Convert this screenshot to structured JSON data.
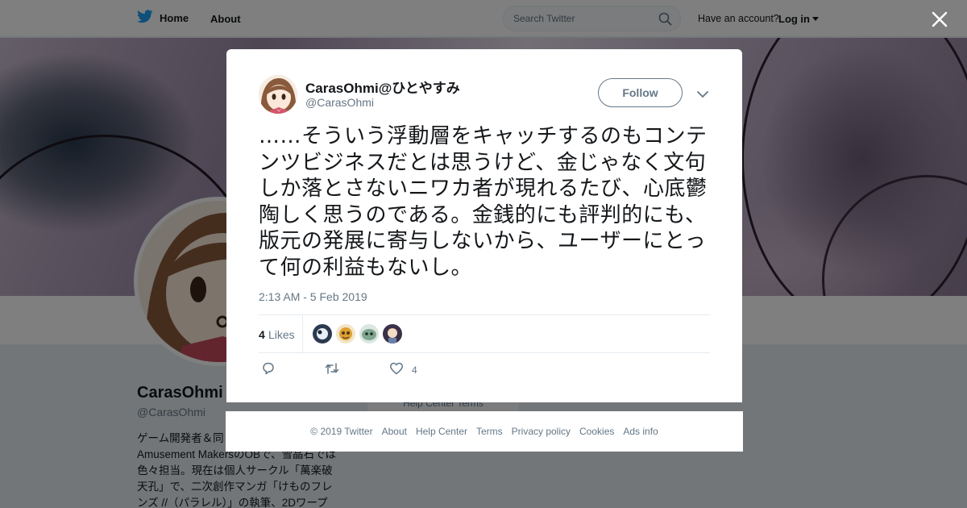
{
  "nav": {
    "home_label": "Home",
    "about_label": "About",
    "search_placeholder": "Search Twitter",
    "account_prompt": "Have an account?",
    "login_label": "Log in"
  },
  "profile": {
    "name": "CarasOhmi",
    "handle": "@CarasOhmi",
    "bio_lines": [
      "ゲーム開発者＆同",
      "Amusement MakersのOBで、雪晶石では",
      "色々担当。現在は個人サークル「萬楽破",
      "天孔」で、二次創作マンガ「けものフレ",
      "ンズ //（パラレル）」の執筆、2Dワープ"
    ],
    "mini_footer": "Help Center    Terms"
  },
  "tweet": {
    "author_name": "CarasOhmi@ひとやすみ",
    "author_handle": "@CarasOhmi",
    "follow_label": "Follow",
    "text": "……そういう浮動層をキャッチするのもコンテンツビジネスだとは思うけど、金じゃなく文句しか落とさないニワカ者が現れるたび、心底鬱陶しく思うのである。金銭的にも評判的にも、版元の発展に寄与しないから、ユーザーにとって何の利益もないし。",
    "timestamp": "2:13 AM - 5 Feb 2019",
    "likes_count": "4",
    "likes_label": "Likes",
    "like_action_count": "4"
  },
  "footer": {
    "copyright": "© 2019 Twitter",
    "links": [
      "About",
      "Help Center",
      "Terms",
      "Privacy policy",
      "Cookies",
      "Ads info"
    ]
  },
  "colors": {
    "twitter_blue": "#1da1f2",
    "text_primary": "#14171a",
    "text_secondary": "#657786",
    "border": "#e6ecf0"
  }
}
